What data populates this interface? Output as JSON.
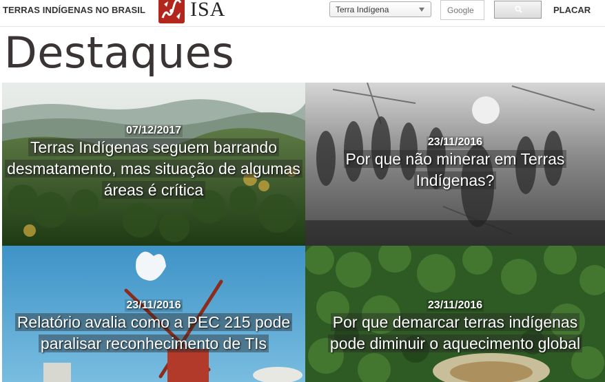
{
  "header": {
    "site_title": "TERRAS INDÍGENAS NO BRASIL",
    "logo_text": "ISA",
    "category_select": {
      "value": "Terra Indígena"
    },
    "search": {
      "placeholder": "Google"
    },
    "search_button_icon": "search-icon",
    "scoreboard_link": "PLACAR"
  },
  "page": {
    "title": "Destaques"
  },
  "cards": [
    {
      "date": "07/12/2017",
      "title": "Terras Indígenas seguem barrando desmatamento, mas situação de algumas áreas é crítica"
    },
    {
      "date": "23/11/2016",
      "title": "Por que não minerar em Terras Indígenas?"
    },
    {
      "date": "23/11/2016",
      "title": "Relatório avalia como a PEC 215 pode paralisar reconhecimento de TIs"
    },
    {
      "date": "23/11/2016",
      "title": "Por que demarcar terras indígenas pode diminuir o aquecimento global"
    }
  ],
  "colors": {
    "logo_red": "#b3261e",
    "title_text": "#3a3434"
  }
}
